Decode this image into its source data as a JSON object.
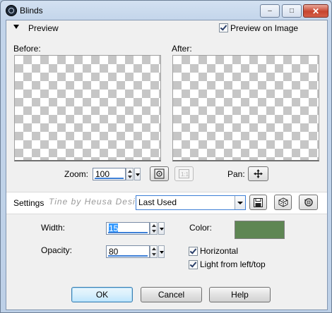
{
  "window": {
    "title": "Blinds",
    "icon": "app-eye-icon",
    "controls": {
      "minimize": "–",
      "maximize": "□",
      "close": "✕"
    }
  },
  "preview_header": {
    "label": "Preview",
    "preview_on_image_label": "Preview on Image",
    "preview_on_image_checked": true
  },
  "panels": {
    "before_label": "Before:",
    "after_label": "After:"
  },
  "zoom": {
    "label": "Zoom:",
    "value": "100"
  },
  "pan": {
    "label": "Pan:",
    "icon": "move-arrows-icon"
  },
  "settings": {
    "label": "Settings",
    "preset_value": "Last Used",
    "watermark": "Tine by Heusa Design"
  },
  "params": {
    "width_label": "Width:",
    "width_value": "15",
    "opacity_label": "Opacity:",
    "opacity_value": "80",
    "color_label": "Color:",
    "color_value": "#5e8653",
    "horizontal_label": "Horizontal",
    "horizontal_checked": true,
    "light_label": "Light from left/top",
    "light_checked": true
  },
  "buttons": {
    "ok": "OK",
    "cancel": "Cancel",
    "help": "Help"
  }
}
